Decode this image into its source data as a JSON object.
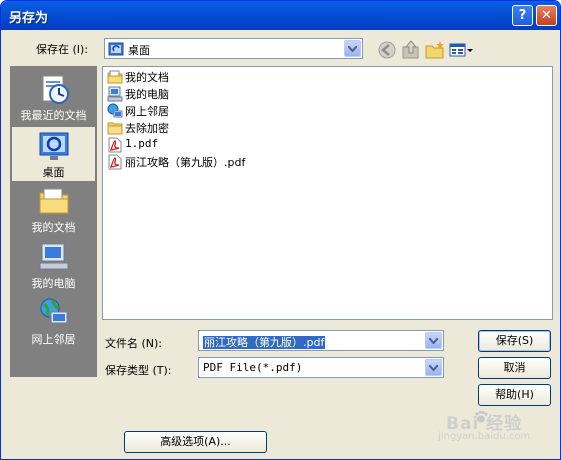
{
  "window": {
    "title": "另存为",
    "help_btn": "?",
    "close_btn": "✕"
  },
  "savein": {
    "label": "保存在 (I):",
    "value": "桌面"
  },
  "places": [
    {
      "label": "我最近的文档"
    },
    {
      "label": "桌面"
    },
    {
      "label": "我的文档"
    },
    {
      "label": "我的电脑"
    },
    {
      "label": "网上邻居"
    }
  ],
  "files": [
    {
      "name": "我的文档",
      "icon": "my-documents-icon"
    },
    {
      "name": "我的电脑",
      "icon": "my-computer-icon"
    },
    {
      "name": "网上邻居",
      "icon": "network-icon"
    },
    {
      "name": "去除加密",
      "icon": "folder-icon"
    },
    {
      "name": "1.pdf",
      "icon": "pdf-icon"
    },
    {
      "name": "丽江攻略（第九版）.pdf",
      "icon": "pdf-icon"
    }
  ],
  "filename": {
    "label": "文件名 (N):",
    "value": "丽江攻略（第九版）.pdf"
  },
  "filetype": {
    "label": "保存类型 (T):",
    "value": "PDF File(*.pdf)"
  },
  "buttons": {
    "save": "保存(S)",
    "cancel": "取消",
    "help": "帮助(H)",
    "advanced": "高级选项(A)..."
  },
  "watermark": {
    "text": "Bai 经验",
    "url": "jingyan.baidu.com"
  }
}
